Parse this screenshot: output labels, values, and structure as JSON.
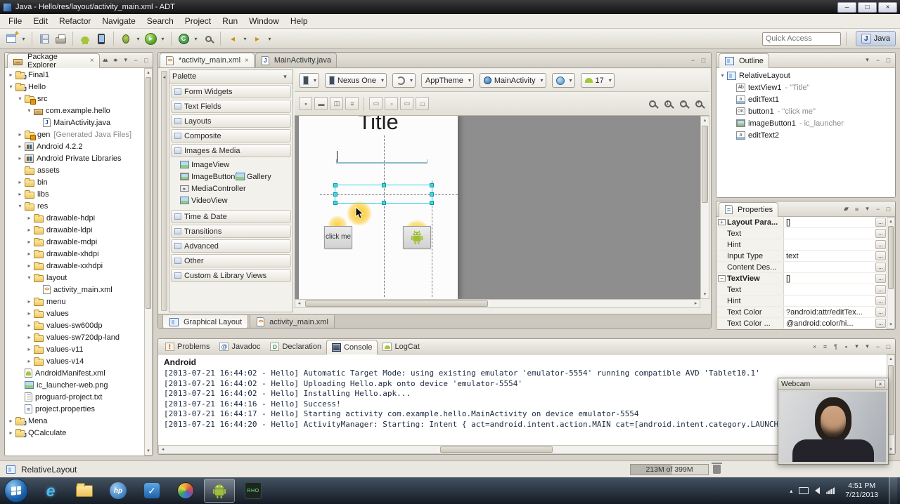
{
  "window": {
    "title": "Java - Hello/res/layout/activity_main.xml - ADT"
  },
  "menubar": [
    "File",
    "Edit",
    "Refactor",
    "Navigate",
    "Search",
    "Project",
    "Run",
    "Window",
    "Help"
  ],
  "toolbar": {
    "quick_access_placeholder": "Quick Access",
    "perspective_label": "Java"
  },
  "colors": {
    "android_green": "#a4c639",
    "selection_handles": "#3fd6e2",
    "holo_field_blue": "#8fb8cc",
    "drag_highlight": "#ffc107"
  },
  "package_explorer": {
    "title": "Package Explorer",
    "items": [
      {
        "label": "Final1",
        "level": 0,
        "icon": "project",
        "expand": "closed"
      },
      {
        "label": "Hello",
        "level": 0,
        "icon": "project",
        "expand": "open"
      },
      {
        "label": "src",
        "level": 1,
        "icon": "src",
        "expand": "open"
      },
      {
        "label": "com.example.hello",
        "level": 2,
        "icon": "package",
        "expand": "open"
      },
      {
        "label": "MainActivity.java",
        "level": 3,
        "icon": "java"
      },
      {
        "label": "gen",
        "suffix": "[Generated Java Files]",
        "level": 1,
        "icon": "src",
        "expand": "closed"
      },
      {
        "label": "Android 4.2.2",
        "level": 1,
        "icon": "lib",
        "expand": "closed"
      },
      {
        "label": "Android Private Libraries",
        "level": 1,
        "icon": "lib",
        "expand": "closed"
      },
      {
        "label": "assets",
        "level": 1,
        "icon": "folder"
      },
      {
        "label": "bin",
        "level": 1,
        "icon": "folder",
        "expand": "closed"
      },
      {
        "label": "libs",
        "level": 1,
        "icon": "folder",
        "expand": "closed"
      },
      {
        "label": "res",
        "level": 1,
        "icon": "folder",
        "expand": "open"
      },
      {
        "label": "drawable-hdpi",
        "level": 2,
        "icon": "folder",
        "expand": "closed"
      },
      {
        "label": "drawable-ldpi",
        "level": 2,
        "icon": "folder",
        "expand": "closed"
      },
      {
        "label": "drawable-mdpi",
        "level": 2,
        "icon": "folder",
        "expand": "closed"
      },
      {
        "label": "drawable-xhdpi",
        "level": 2,
        "icon": "folder",
        "expand": "closed"
      },
      {
        "label": "drawable-xxhdpi",
        "level": 2,
        "icon": "folder",
        "expand": "closed"
      },
      {
        "label": "layout",
        "level": 2,
        "icon": "folder",
        "expand": "open"
      },
      {
        "label": "activity_main.xml",
        "level": 3,
        "icon": "xml"
      },
      {
        "label": "menu",
        "level": 2,
        "icon": "folder",
        "expand": "closed"
      },
      {
        "label": "values",
        "level": 2,
        "icon": "folder",
        "expand": "closed"
      },
      {
        "label": "values-sw600dp",
        "level": 2,
        "icon": "folder",
        "expand": "closed"
      },
      {
        "label": "values-sw720dp-land",
        "level": 2,
        "icon": "folder",
        "expand": "closed"
      },
      {
        "label": "values-v11",
        "level": 2,
        "icon": "folder",
        "expand": "closed"
      },
      {
        "label": "values-v14",
        "level": 2,
        "icon": "folder",
        "expand": "closed"
      },
      {
        "label": "AndroidManifest.xml",
        "level": 1,
        "icon": "manifest"
      },
      {
        "label": "ic_launcher-web.png",
        "level": 1,
        "icon": "png"
      },
      {
        "label": "proguard-project.txt",
        "level": 1,
        "icon": "txt"
      },
      {
        "label": "project.properties",
        "level": 1,
        "icon": "prop"
      },
      {
        "label": "Mena",
        "level": 0,
        "icon": "project",
        "expand": "closed"
      },
      {
        "label": "QCalculate",
        "level": 0,
        "icon": "project",
        "expand": "closed"
      }
    ]
  },
  "editor": {
    "tabs": [
      {
        "label": "*activity_main.xml",
        "icon": "xml",
        "active": true
      },
      {
        "label": "MainActivity.java",
        "icon": "java",
        "active": false
      }
    ],
    "palette": {
      "title": "Palette",
      "sections": [
        {
          "label": "Form Widgets"
        },
        {
          "label": "Text Fields"
        },
        {
          "label": "Layouts"
        },
        {
          "label": "Composite"
        },
        {
          "label": "Images & Media",
          "items": [
            {
              "label": "ImageView",
              "icon": "imageview"
            },
            {
              "label": "ImageButton",
              "icon": "imagebutton",
              "half": true
            },
            {
              "label": "Gallery",
              "icon": "gallery",
              "half": true
            },
            {
              "label": "MediaController",
              "icon": "mediacontroller"
            },
            {
              "label": "VideoView",
              "icon": "videoview"
            }
          ]
        },
        {
          "label": "Time & Date"
        },
        {
          "label": "Transitions"
        },
        {
          "label": "Advanced"
        },
        {
          "label": "Other"
        },
        {
          "label": "Custom & Library Views"
        }
      ]
    },
    "config": {
      "device": "Nexus One",
      "theme": "AppTheme",
      "activity": "MainActivity",
      "api_level": "17"
    },
    "canvas": {
      "title_text": "Title",
      "button_label": "click me"
    },
    "bottom_tabs": [
      {
        "label": "Graphical Layout",
        "icon": "layout",
        "active": true
      },
      {
        "label": "activity_main.xml",
        "icon": "xml",
        "active": false
      }
    ]
  },
  "outline": {
    "title": "Outline",
    "items": [
      {
        "label": "RelativeLayout",
        "level": 0,
        "icon": "layout",
        "expand": "open"
      },
      {
        "label": "textView1",
        "suffix": "- \"Title\"",
        "level": 1,
        "icon": "textview"
      },
      {
        "label": "editText1",
        "level": 1,
        "icon": "edittext"
      },
      {
        "label": "button1",
        "suffix": "- \"click me\"",
        "level": 1,
        "icon": "button"
      },
      {
        "label": "imageButton1",
        "suffix": "- ic_launcher",
        "level": 1,
        "icon": "imagebutton"
      },
      {
        "label": "editText2",
        "level": 1,
        "icon": "edittext"
      }
    ]
  },
  "properties": {
    "title": "Properties",
    "rows": [
      {
        "name": "Layout Para...",
        "value": "[]",
        "group": true,
        "expander": "+"
      },
      {
        "name": "Text",
        "value": ""
      },
      {
        "name": "Hint",
        "value": ""
      },
      {
        "name": "Input Type",
        "value": "text"
      },
      {
        "name": "Content Des...",
        "value": ""
      },
      {
        "name": "TextView",
        "value": "[]",
        "group": true,
        "expander": "−"
      },
      {
        "name": "Text",
        "value": ""
      },
      {
        "name": "Hint",
        "value": ""
      },
      {
        "name": "Text Color",
        "value": "?android:attr/editTex..."
      },
      {
        "name": "Text Color ...",
        "value": "@android:color/hi..."
      }
    ]
  },
  "console": {
    "tabs": [
      {
        "label": "Problems",
        "icon": "problems"
      },
      {
        "label": "Javadoc",
        "icon": "javadoc"
      },
      {
        "label": "Declaration",
        "icon": "declaration"
      },
      {
        "label": "Console",
        "icon": "console",
        "active": true
      },
      {
        "label": "LogCat",
        "icon": "logcat"
      }
    ],
    "header": "Android",
    "lines": [
      "[2013-07-21 16:44:02 - Hello] Automatic Target Mode: using existing emulator 'emulator-5554' running compatible AVD 'Tablet10.1'",
      "[2013-07-21 16:44:02 - Hello] Uploading Hello.apk onto device 'emulator-5554'",
      "[2013-07-21 16:44:02 - Hello] Installing Hello.apk...",
      "[2013-07-21 16:44:16 - Hello] Success!",
      "[2013-07-21 16:44:17 - Hello] Starting activity com.example.hello.MainActivity on device emulator-5554",
      "[2013-07-21 16:44:20 - Hello] ActivityManager: Starting: Intent { act=android.intent.action.MAIN cat=[android.intent.category.LAUNCH"
    ]
  },
  "statusbar": {
    "selection": "RelativeLayout",
    "memory": "213M of 399M"
  },
  "webcam": {
    "title": "Webcam"
  },
  "taskbar": {
    "rho_label": "RHO",
    "clock_time": "4:51 PM",
    "clock_date": "7/21/2013"
  }
}
